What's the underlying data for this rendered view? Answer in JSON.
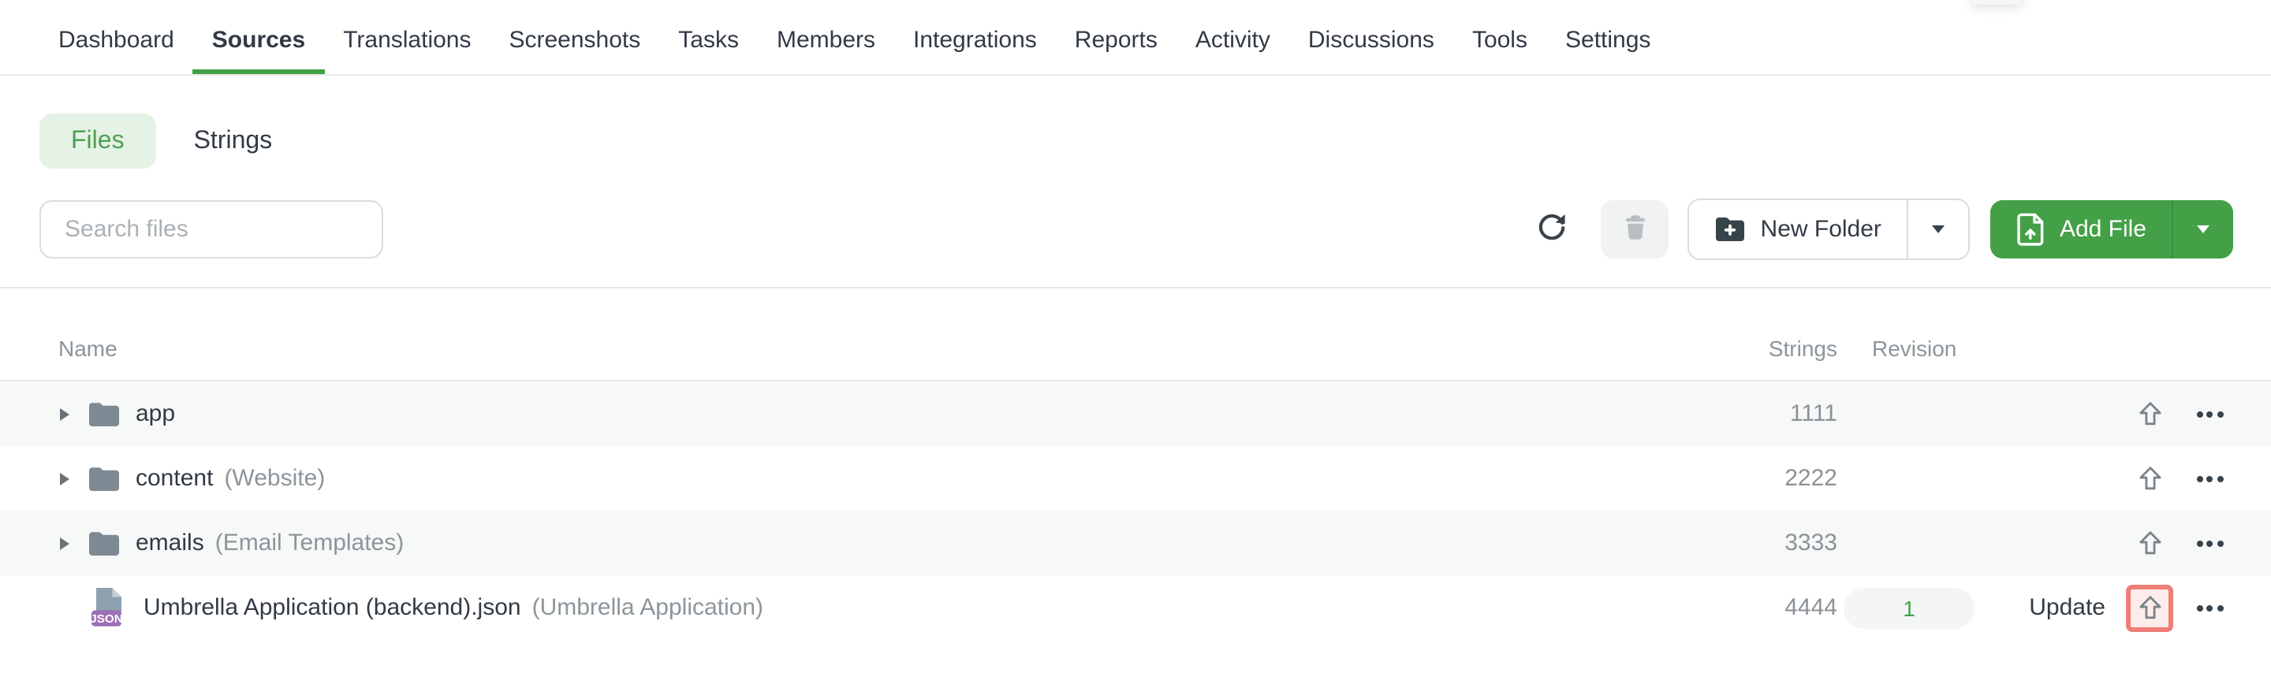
{
  "accent_color": "#43a047",
  "highlight_color": "#ee7f78",
  "nav": {
    "items": [
      {
        "label": "Dashboard",
        "active": false
      },
      {
        "label": "Sources",
        "active": true
      },
      {
        "label": "Translations",
        "active": false
      },
      {
        "label": "Screenshots",
        "active": false
      },
      {
        "label": "Tasks",
        "active": false
      },
      {
        "label": "Members",
        "active": false
      },
      {
        "label": "Integrations",
        "active": false
      },
      {
        "label": "Reports",
        "active": false
      },
      {
        "label": "Activity",
        "active": false
      },
      {
        "label": "Discussions",
        "active": false
      },
      {
        "label": "Tools",
        "active": false
      },
      {
        "label": "Settings",
        "active": false
      }
    ]
  },
  "view_tabs": {
    "files_label": "Files",
    "strings_label": "Strings"
  },
  "toolbar": {
    "search_placeholder": "Search files",
    "refresh_icon": "refresh-icon",
    "delete_icon": "trash-icon",
    "new_folder_label": "New Folder",
    "add_file_label": "Add File"
  },
  "table": {
    "columns": {
      "name": "Name",
      "strings": "Strings",
      "revision": "Revision"
    },
    "rows": [
      {
        "type": "folder",
        "name": "app",
        "annotation": "",
        "strings": "1111",
        "revision": "",
        "update_label": "",
        "highlight_upload": false
      },
      {
        "type": "folder",
        "name": "content",
        "annotation": "(Website)",
        "strings": "2222",
        "revision": "",
        "update_label": "",
        "highlight_upload": false
      },
      {
        "type": "folder",
        "name": "emails",
        "annotation": "(Email Templates)",
        "strings": "3333",
        "revision": "",
        "update_label": "",
        "highlight_upload": false
      },
      {
        "type": "file",
        "file_ext": "JSON",
        "name": "Umbrella Application (backend).json",
        "annotation": "(Umbrella Application)",
        "strings": "4444",
        "revision": "1",
        "update_label": "Update",
        "highlight_upload": true
      }
    ]
  }
}
